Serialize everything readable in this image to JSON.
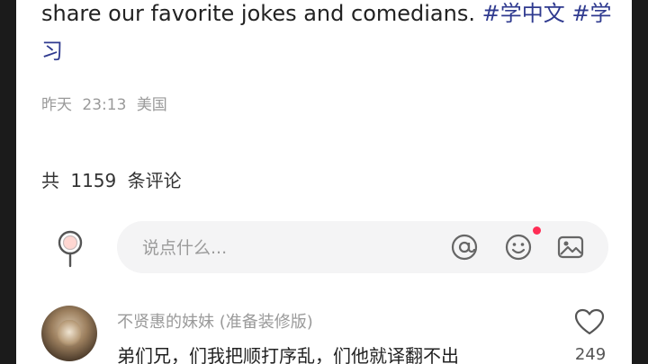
{
  "post": {
    "text": "share our favorite jokes and comedians.",
    "tags": [
      "#学中文",
      "#学习"
    ],
    "meta": {
      "date": "昨天",
      "time": "23:13",
      "location": "美国"
    }
  },
  "comments_header": {
    "prefix": "共",
    "count": "1159",
    "suffix": "条评论"
  },
  "comment_bar": {
    "placeholder": "说点什么...",
    "icons": [
      "pin-icon",
      "at-icon",
      "emoji-icon",
      "image-icon"
    ],
    "emoji_has_notification": true
  },
  "comments": [
    {
      "username": "不贤惠的妹妹 (准备装修版)",
      "text": "弟们兄，们我把顺打序乱，们他就译翻不出",
      "likes": "249"
    }
  ],
  "colors": {
    "hashtag": "#2f3a8f",
    "notification_dot": "#ff2d55"
  }
}
